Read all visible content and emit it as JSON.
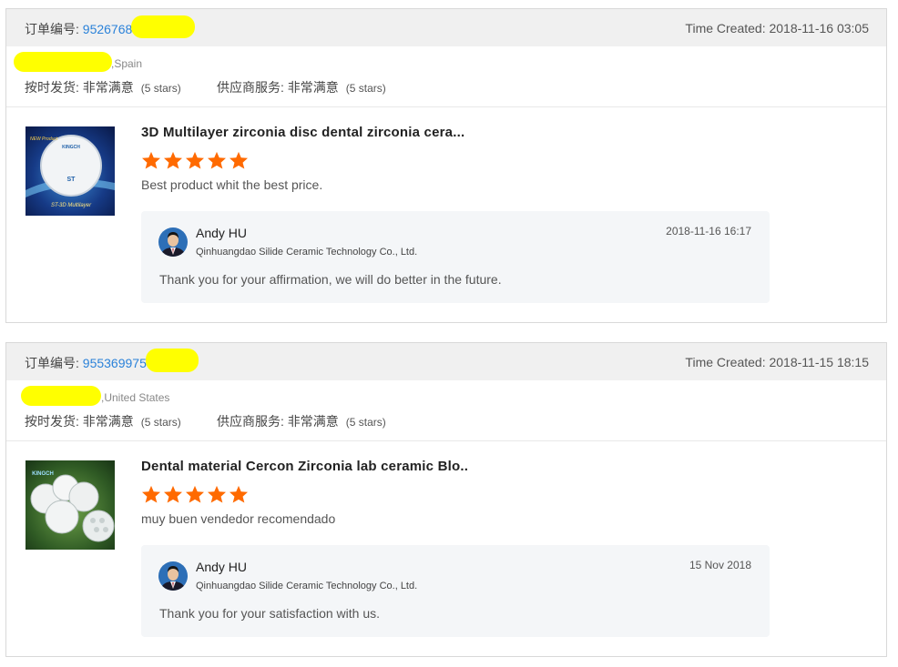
{
  "colors": {
    "star": "#ff6a00",
    "link": "#2b82d9",
    "highlight": "#ffff00"
  },
  "orders": [
    {
      "order_label": "订单编号:",
      "order_number": "9526768",
      "time_created": "Time Created: 2018-11-16 03:05",
      "buyer_country": ",Spain",
      "rating_shipping_label": "按时发货: 非常满意",
      "rating_shipping_stars": "(5 stars)",
      "rating_service_label": "供应商服务: 非常满意",
      "rating_service_stars": "(5 stars)",
      "product_title": "3D Multilayer zirconia disc dental zirconia cera...",
      "stars": 5,
      "review": "Best product whit the best price.",
      "reply": {
        "name": "Andy HU",
        "company": "Qinhuangdao Silide Ceramic Technology Co., Ltd.",
        "date": "2018-11-16 16:17",
        "text": "Thank you for your affirmation, we will do better in the future."
      },
      "thumb_text": "NEW Product · KINGCH · ST · ST-3D Multilayer"
    },
    {
      "order_label": "订单编号:",
      "order_number": "955369975",
      "time_created": "Time Created: 2018-11-15 18:15",
      "buyer_country": ",United States",
      "rating_shipping_label": "按时发货: 非常满意",
      "rating_shipping_stars": "(5 stars)",
      "rating_service_label": "供应商服务: 非常满意",
      "rating_service_stars": "(5 stars)",
      "product_title": "Dental material Cercon Zirconia lab ceramic Blo..",
      "stars": 5,
      "review": "muy buen vendedor recomendado",
      "reply": {
        "name": "Andy HU",
        "company": "Qinhuangdao Silide Ceramic Technology Co., Ltd.",
        "date": "15 Nov 2018",
        "text": "Thank you for your satisfaction with us."
      },
      "thumb_text": "KINGCH"
    }
  ]
}
